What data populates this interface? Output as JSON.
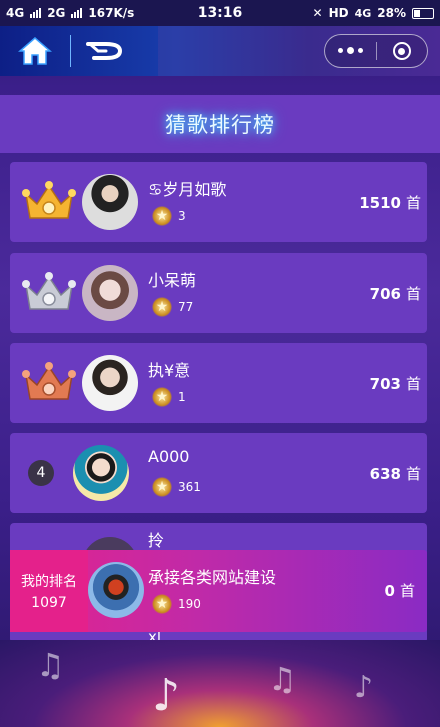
{
  "status_bar": {
    "sim1": "4G",
    "sim2": "2G",
    "speed": "167K/s",
    "time": "13:16",
    "hd": "HD",
    "network": "4G",
    "battery": "28%"
  },
  "nav": {
    "home_icon": "home-icon",
    "back_icon": "back-arrow-icon",
    "more_icon": "more-dots-icon",
    "close_icon": "target-circle-icon"
  },
  "title": "猜歌排行榜",
  "unit": "首",
  "leaderboard": [
    {
      "rank_badge": "",
      "crown": "gold",
      "name": "♋岁月如歌",
      "stars": "3",
      "count": "1510"
    },
    {
      "rank_badge": "",
      "crown": "silver",
      "name": "小呆萌",
      "stars": "77",
      "count": "706"
    },
    {
      "rank_badge": "",
      "crown": "bronze",
      "name": "执¥意",
      "stars": "1",
      "count": "703"
    },
    {
      "rank_badge": "4",
      "crown": "",
      "name": "A000",
      "stars": "361",
      "count": "638"
    },
    {
      "rank_badge": "",
      "crown": "",
      "name": "拎",
      "stars": "",
      "count": ""
    },
    {
      "rank_badge": "",
      "crown": "",
      "name": "xl",
      "stars": "",
      "count": ""
    }
  ],
  "my_rank": {
    "label": "我的排名",
    "rank": "1097",
    "name": "承接各类网站建设",
    "stars": "190",
    "count": "0"
  },
  "colors": {
    "panel": "#6a3bc0",
    "title_glow": "#3fd2ff",
    "my_rank_bg": "#e4218b",
    "gold": "#f5b431",
    "silver": "#c9ccd6",
    "bronze": "#e27a52"
  }
}
